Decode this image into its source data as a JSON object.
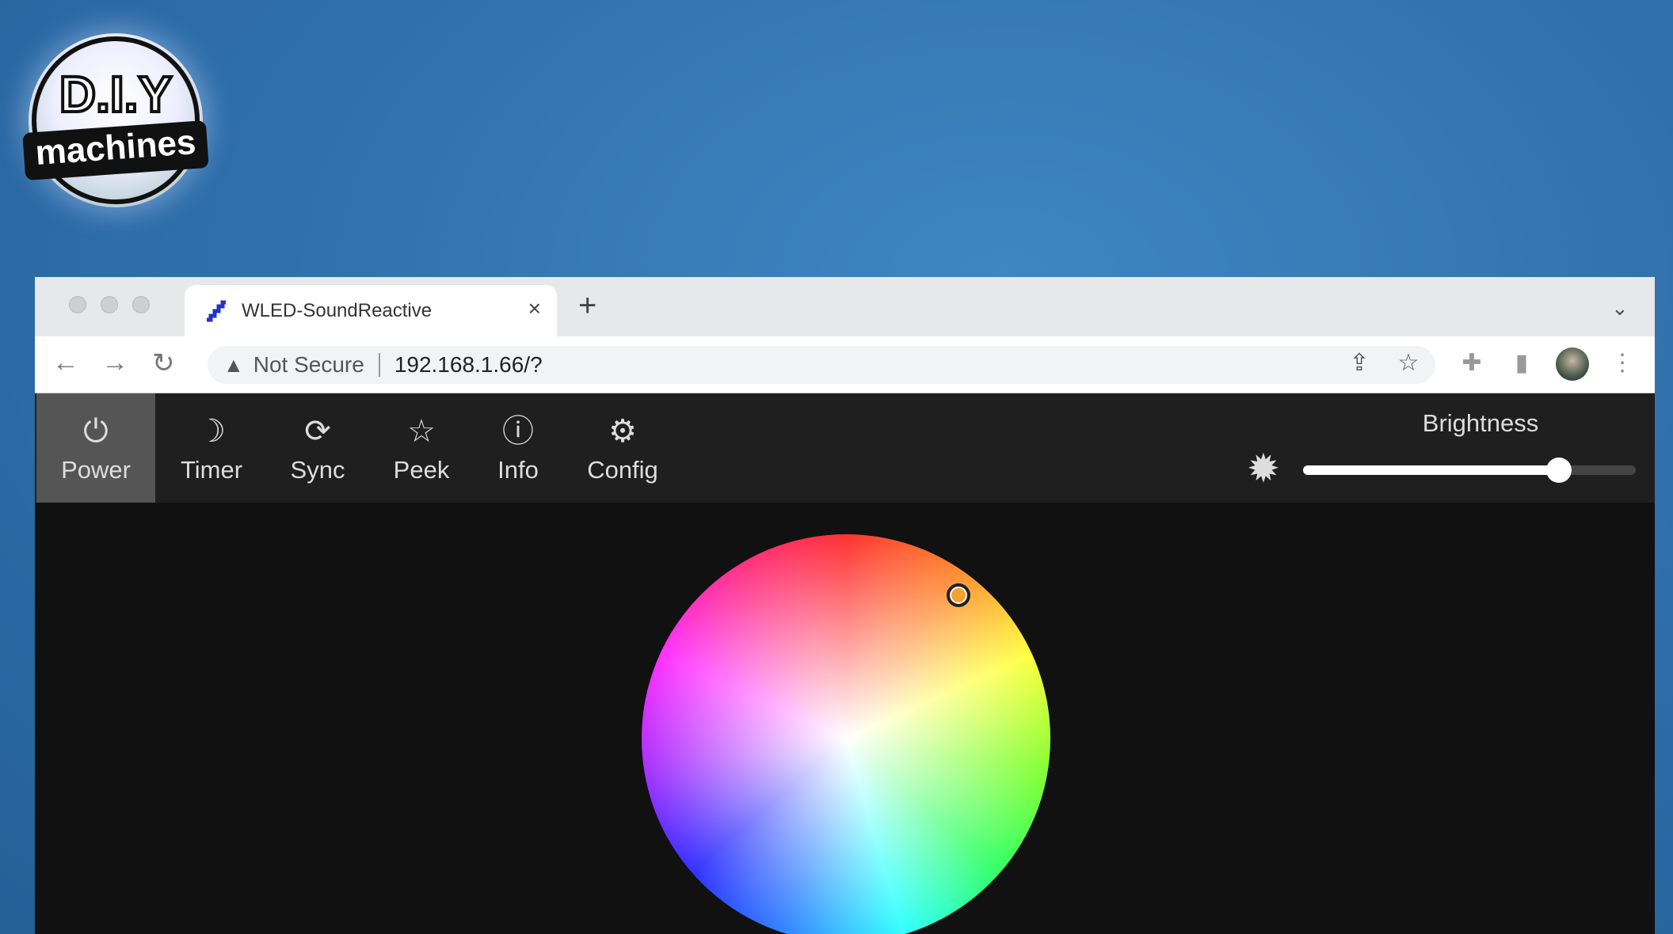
{
  "logo": {
    "line1": "D.I.Y",
    "line2": "machines"
  },
  "browser": {
    "tab": {
      "title": "WLED-SoundReactive",
      "close": "×"
    },
    "new_tab": "+",
    "address": {
      "warning": "Not Secure",
      "url": "192.168.1.66/?"
    }
  },
  "toolbar": {
    "buttons": [
      {
        "label": "Power",
        "icon": "power-icon",
        "active": true
      },
      {
        "label": "Timer",
        "icon": "moon-icon"
      },
      {
        "label": "Sync",
        "icon": "sync-icon"
      },
      {
        "label": "Peek",
        "icon": "star-icon"
      },
      {
        "label": "Info",
        "icon": "info-icon"
      },
      {
        "label": "Config",
        "icon": "gear-icon"
      }
    ],
    "brightness": {
      "label": "Brightness",
      "value_fraction": 0.77
    }
  },
  "color_picker": {
    "selected_color": "#f5a030"
  }
}
